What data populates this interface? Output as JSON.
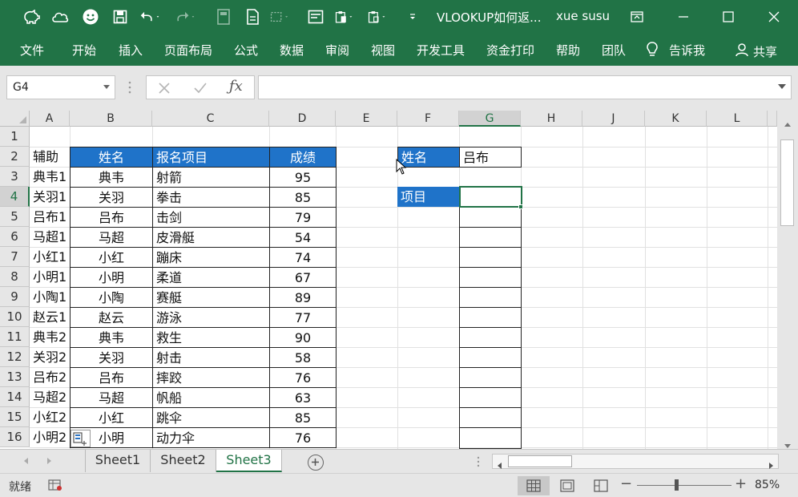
{
  "window": {
    "title": "VLOOKUP如何返...",
    "user": "xue susu"
  },
  "ribbon_tabs": [
    "文件",
    "开始",
    "插入",
    "页面布局",
    "公式",
    "数据",
    "审阅",
    "视图",
    "开发工具",
    "资金打印",
    "帮助",
    "团队",
    "告诉我",
    "共享"
  ],
  "formula_bar": {
    "name_box": "G4",
    "formula": ""
  },
  "columns": [
    "A",
    "B",
    "C",
    "D",
    "E",
    "F",
    "G",
    "H",
    "J",
    "K",
    "L"
  ],
  "selected_column": "G",
  "rows": [
    "1",
    "2",
    "3",
    "4",
    "5",
    "6",
    "7",
    "8",
    "9",
    "10",
    "11",
    "12",
    "13",
    "14",
    "15",
    "16"
  ],
  "selected_row": "4",
  "table": {
    "headers": {
      "helper": "辅助",
      "name": "姓名",
      "event": "报名项目",
      "score": "成绩"
    },
    "records": [
      {
        "helper": "典韦1",
        "name": "典韦",
        "event": "射箭",
        "score": "95"
      },
      {
        "helper": "关羽1",
        "name": "关羽",
        "event": "拳击",
        "score": "85"
      },
      {
        "helper": "吕布1",
        "name": "吕布",
        "event": "击剑",
        "score": "79"
      },
      {
        "helper": "马超1",
        "name": "马超",
        "event": "皮滑艇",
        "score": "54"
      },
      {
        "helper": "小红1",
        "name": "小红",
        "event": "蹦床",
        "score": "74"
      },
      {
        "helper": "小明1",
        "name": "小明",
        "event": "柔道",
        "score": "67"
      },
      {
        "helper": "小陶1",
        "name": "小陶",
        "event": "赛艇",
        "score": "89"
      },
      {
        "helper": "赵云1",
        "name": "赵云",
        "event": "游泳",
        "score": "77"
      },
      {
        "helper": "典韦2",
        "name": "典韦",
        "event": "救生",
        "score": "90"
      },
      {
        "helper": "关羽2",
        "name": "关羽",
        "event": "射击",
        "score": "58"
      },
      {
        "helper": "吕布2",
        "name": "吕布",
        "event": "摔跤",
        "score": "76"
      },
      {
        "helper": "马超2",
        "name": "马超",
        "event": "帆船",
        "score": "63"
      },
      {
        "helper": "小红2",
        "name": "小红",
        "event": "跳伞",
        "score": "85"
      },
      {
        "helper": "小明2",
        "name": "小明",
        "event": "动力伞",
        "score": "76"
      }
    ]
  },
  "lookup": {
    "name_label": "姓名",
    "name_value": "吕布",
    "item_label": "项目"
  },
  "sheets": [
    "Sheet1",
    "Sheet2",
    "Sheet3"
  ],
  "active_sheet": "Sheet3",
  "status": {
    "ready": "就绪",
    "zoom": "85%"
  },
  "colors": {
    "excel_green": "#217346",
    "header_blue": "#1f73c9"
  }
}
